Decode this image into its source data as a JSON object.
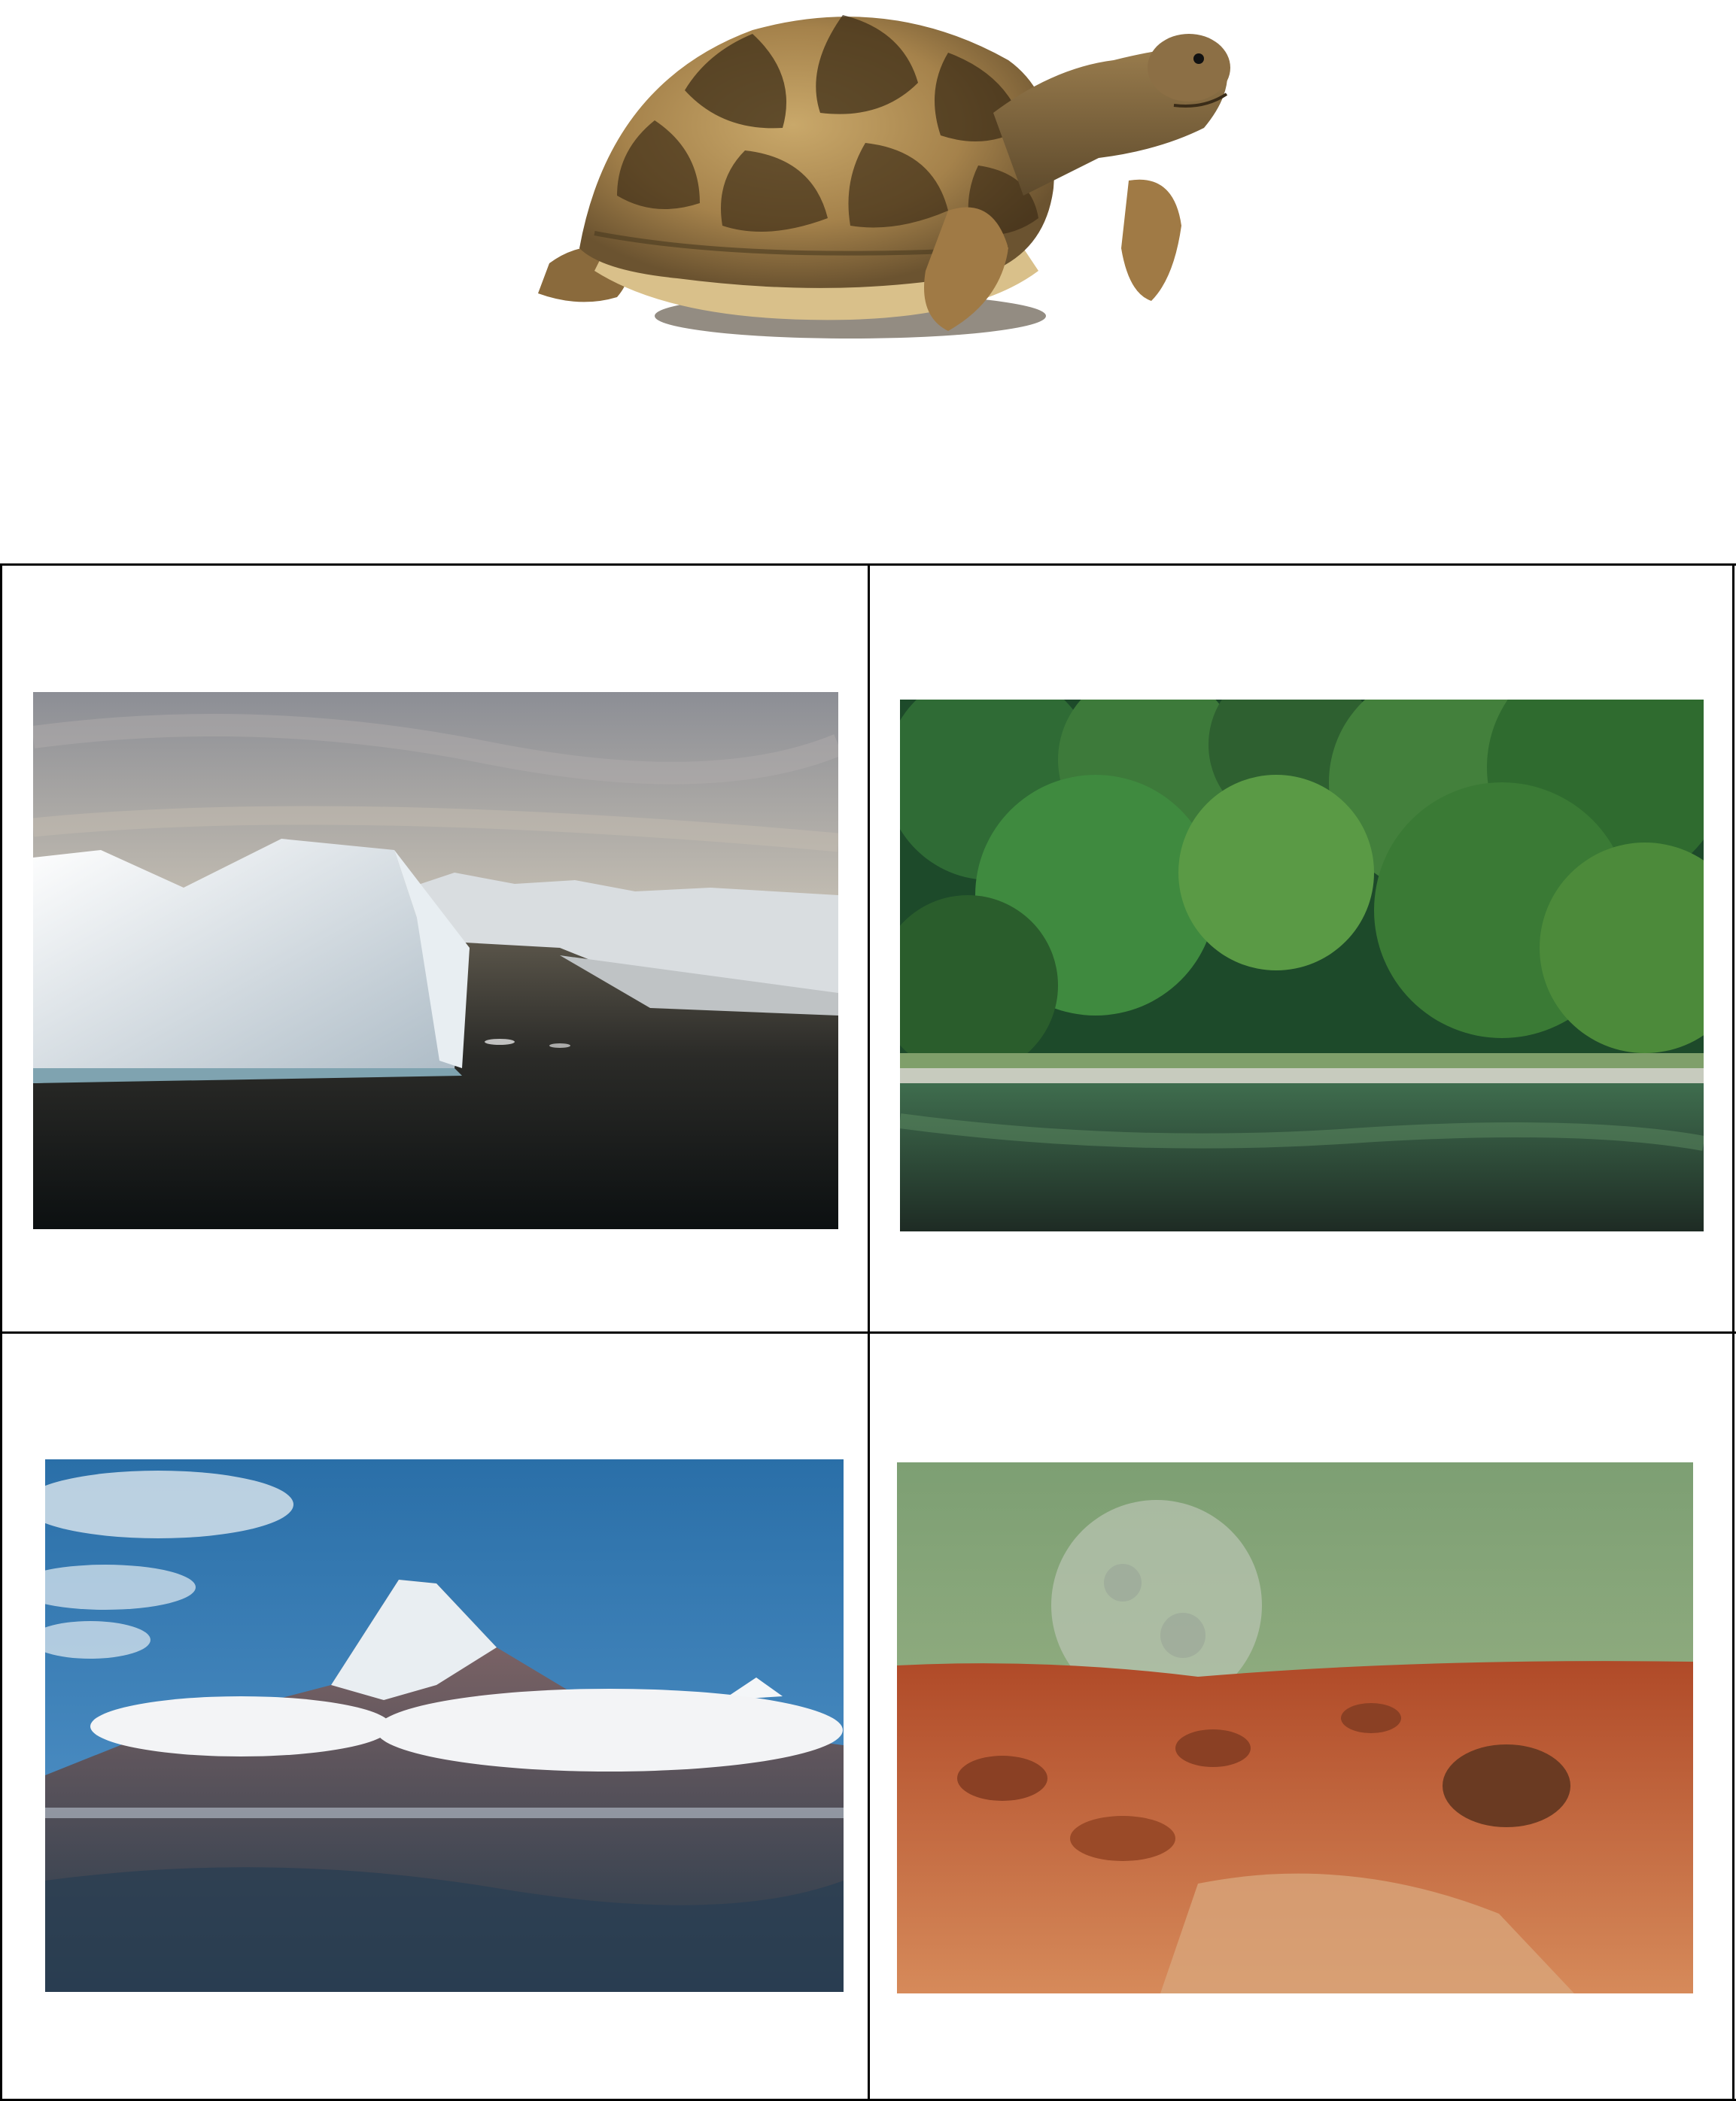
{
  "header_image": {
    "subject": "tortoise",
    "alt": ""
  },
  "grid": {
    "line_color": "#000000",
    "cells": [
      {
        "id": "iceberg",
        "scene": "arctic-iceberg",
        "alt": ""
      },
      {
        "id": "forest",
        "scene": "forest-river",
        "alt": ""
      },
      {
        "id": "mountain",
        "scene": "snowy-mountain-peak",
        "alt": ""
      },
      {
        "id": "desert",
        "scene": "red-rocky-planet",
        "alt": ""
      }
    ]
  }
}
